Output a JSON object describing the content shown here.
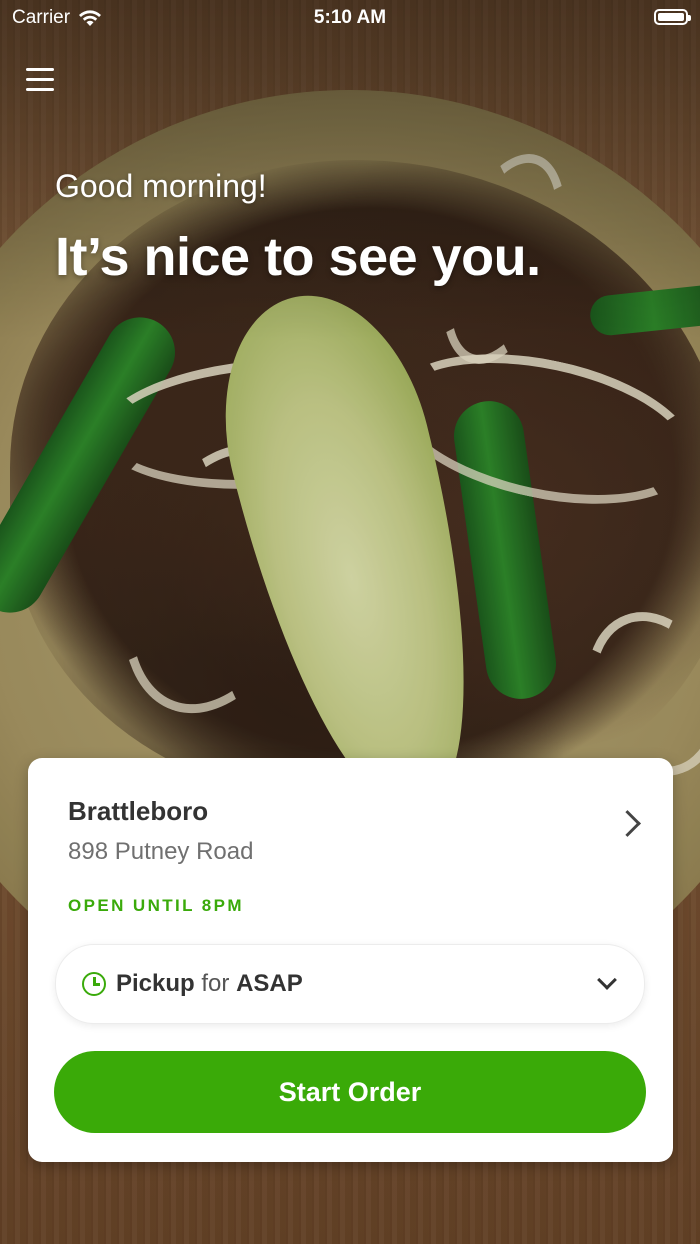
{
  "status_bar": {
    "carrier": "Carrier",
    "time": "5:10 AM",
    "battery_level": 1.0
  },
  "icons": {
    "menu": "hamburger-menu-icon",
    "wifi": "wifi-icon",
    "battery": "battery-icon",
    "location_chevron": "chevron-right-icon",
    "clock": "clock-icon",
    "dropdown": "chevron-down-icon"
  },
  "greeting": {
    "salutation": "Good morning!",
    "headline": "It’s nice to see you."
  },
  "location": {
    "name": "Brattleboro",
    "address": "898 Putney Road",
    "hours_status": "OPEN UNTIL 8PM"
  },
  "order_options": {
    "mode": "Pickup",
    "connector": "for",
    "time": "ASAP"
  },
  "actions": {
    "start_order_label": "Start Order"
  },
  "colors": {
    "accent_green": "#3aaa08",
    "text_dark": "#333333",
    "text_muted": "#707070",
    "card_background": "#ffffff"
  }
}
